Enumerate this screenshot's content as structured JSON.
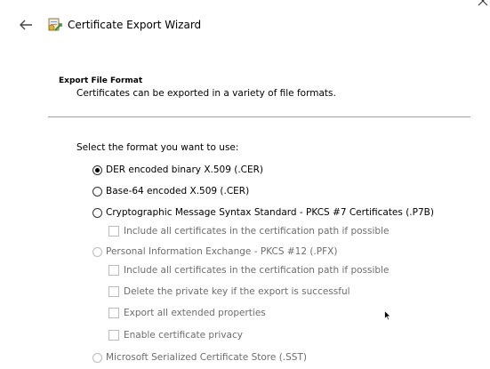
{
  "window": {
    "title": "Certificate Export Wizard",
    "close_glyph": "✕",
    "back_glyph": "←"
  },
  "section": {
    "title": "Export File Format",
    "description": "Certificates can be exported in a variety of file formats."
  },
  "form": {
    "prompt": "Select the format you want to use:",
    "options": [
      {
        "label": "DER encoded binary X.509 (.CER)",
        "type": "radio",
        "checked": true,
        "enabled": true
      },
      {
        "label": "Base-64 encoded X.509 (.CER)",
        "type": "radio",
        "checked": false,
        "enabled": true
      },
      {
        "label": "Cryptographic Message Syntax Standard - PKCS #7 Certificates (.P7B)",
        "type": "radio",
        "checked": false,
        "enabled": true
      },
      {
        "label": "Include all certificates in the certification path if possible",
        "type": "checkbox",
        "checked": false,
        "enabled": false
      },
      {
        "label": "Personal Information Exchange - PKCS #12 (.PFX)",
        "type": "radio",
        "checked": false,
        "enabled": false
      },
      {
        "label": "Include all certificates in the certification path if possible",
        "type": "checkbox",
        "checked": false,
        "enabled": false
      },
      {
        "label": "Delete the private key if the export is successful",
        "type": "checkbox",
        "checked": false,
        "enabled": false
      },
      {
        "label": "Export all extended properties",
        "type": "checkbox",
        "checked": false,
        "enabled": false
      },
      {
        "label": "Enable certificate privacy",
        "type": "checkbox",
        "checked": false,
        "enabled": false
      },
      {
        "label": "Microsoft Serialized Certificate Store (.SST)",
        "type": "radio",
        "checked": false,
        "enabled": false
      }
    ]
  },
  "icons": {
    "back": "back-arrow-icon",
    "wizard": "certificate-icon",
    "close": "close-icon",
    "cursor": "mouse-pointer-icon"
  }
}
